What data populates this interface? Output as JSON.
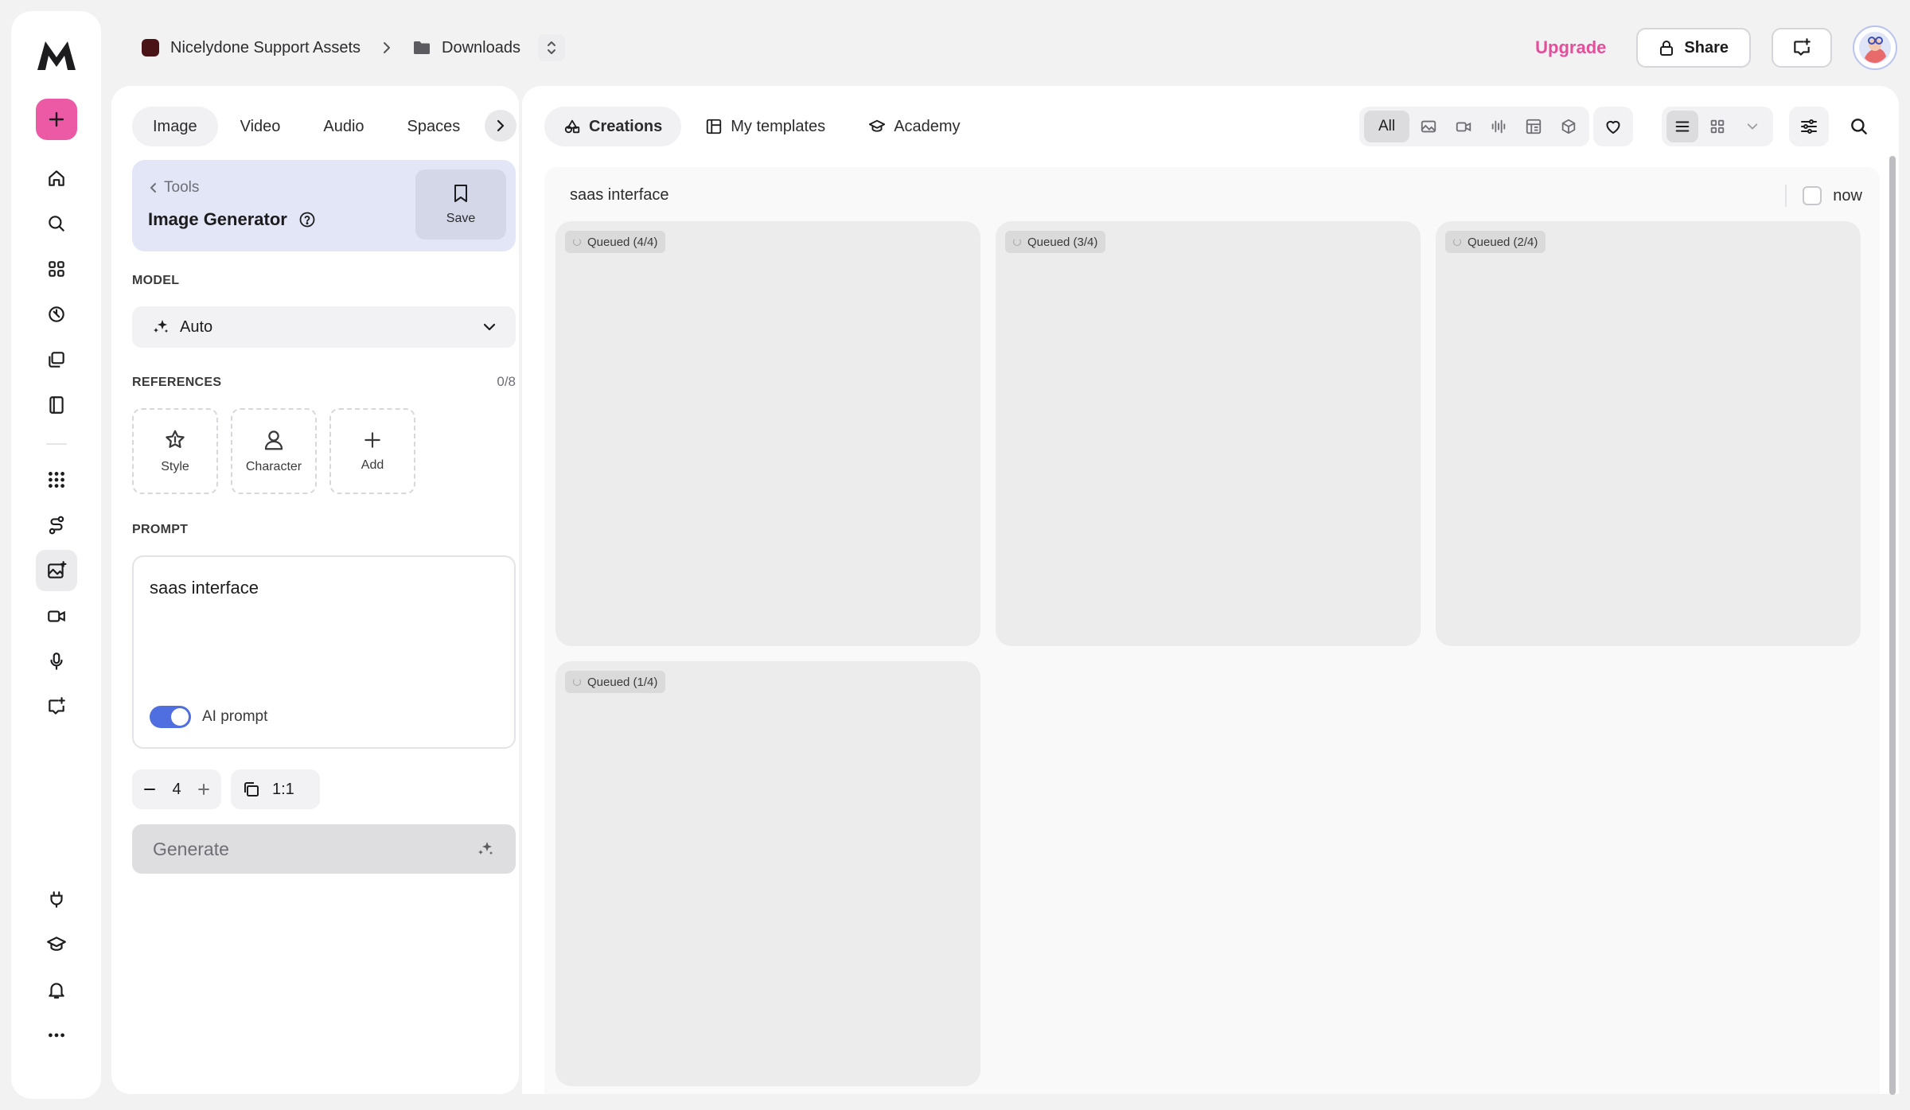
{
  "breadcrumb": {
    "workspace": "Nicelydone Support Assets",
    "folder": "Downloads"
  },
  "header": {
    "upgrade_label": "Upgrade",
    "share_label": "Share"
  },
  "panel": {
    "tabs": [
      "Image",
      "Video",
      "Audio",
      "Spaces"
    ],
    "active_tab": "Image",
    "tool": {
      "back_label": "Tools",
      "title": "Image Generator",
      "save_label": "Save"
    },
    "model": {
      "label": "MODEL",
      "value": "Auto"
    },
    "references": {
      "label": "REFERENCES",
      "count": "0/8",
      "items": [
        "Style",
        "Character",
        "Add"
      ]
    },
    "prompt": {
      "label": "PROMPT",
      "value": "saas interface",
      "ai_prompt_label": "AI prompt",
      "ai_prompt_enabled": true
    },
    "quantity": "4",
    "aspect_ratio": "1:1",
    "generate_label": "Generate"
  },
  "main": {
    "tabs": [
      "Creations",
      "My templates",
      "Academy"
    ],
    "active_tab": "Creations",
    "filters": {
      "all_label": "All",
      "icons": [
        "image-filter-icon",
        "video-filter-icon",
        "audio-filter-icon",
        "template-filter-icon",
        "3d-filter-icon"
      ]
    },
    "query": "saas interface",
    "now_label": "now",
    "cards": [
      {
        "status": "Queued (4/4)"
      },
      {
        "status": "Queued (3/4)"
      },
      {
        "status": "Queued (2/4)"
      },
      {
        "status": "Queued (1/4)"
      }
    ]
  },
  "colors": {
    "accent_pink": "#ec5aa5",
    "upgrade_pink": "#e34f9a",
    "toggle_blue": "#4f6ee0",
    "tool_card_bg": "#e2e6f6"
  }
}
